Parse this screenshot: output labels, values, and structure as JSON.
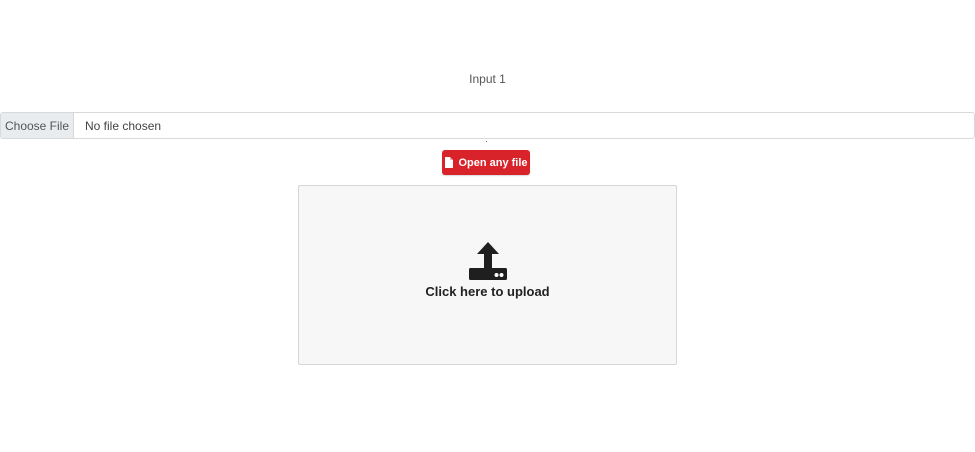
{
  "form": {
    "input_label": "Input 1",
    "file_input": {
      "button_label": "Choose File",
      "status_text": "No file chosen"
    },
    "open_button": {
      "label": "Open any file",
      "icon": "document-icon",
      "color": "#d9232a"
    },
    "upload_zone": {
      "label": "Click here to upload",
      "icon": "upload-tray-icon"
    }
  }
}
